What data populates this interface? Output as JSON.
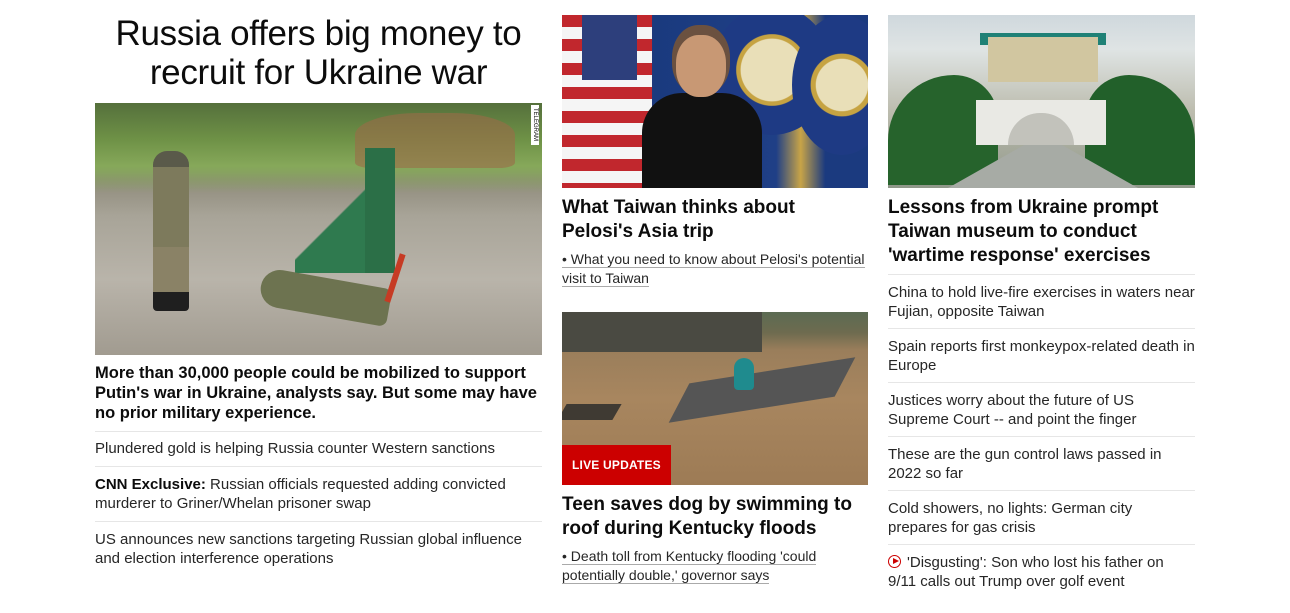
{
  "main_story": {
    "headline": "Russia offers big money to recruit for Ukraine war",
    "image_credit": "TELEGRAM",
    "lede": "More than 30,000 people could be mobilized to support Putin's war in Ukraine, analysts say. But some may have no prior military experience.",
    "related": [
      {
        "prefix": "",
        "text": "Plundered gold is helping Russia counter Western sanctions"
      },
      {
        "prefix": "CNN Exclusive:",
        "text": " Russian officials requested adding convicted murderer to Griner/Whelan prisoner swap"
      },
      {
        "prefix": "",
        "text": "US announces new sanctions targeting Russian global influence and election interference operations"
      }
    ]
  },
  "pelosi_story": {
    "headline": "What Taiwan thinks about Pelosi's Asia trip",
    "sub": "• What you need to know about Pelosi's potential visit to Taiwan"
  },
  "flood_story": {
    "badge": "LIVE UPDATES",
    "headline": "Teen saves dog by swimming to roof during Kentucky floods",
    "sub": "• Death toll from Kentucky flooding 'could potentially double,' governor says"
  },
  "museum_story": {
    "headline": "Lessons from Ukraine prompt Taiwan museum to conduct 'wartime response' exercises",
    "related": [
      "China to hold live-fire exercises in waters near Fujian, opposite Taiwan",
      "Spain reports first monkeypox-related death in Europe",
      "Justices worry about the future of US Supreme Court -- and point the finger",
      "These are the gun control laws passed in 2022 so far",
      "Cold showers, no lights: German city prepares for gas crisis",
      "'Disgusting': Son who lost his father on 9/11 calls out Trump over golf event"
    ],
    "video_icon": "play-circle-icon",
    "accent_color": "#cc0000"
  }
}
